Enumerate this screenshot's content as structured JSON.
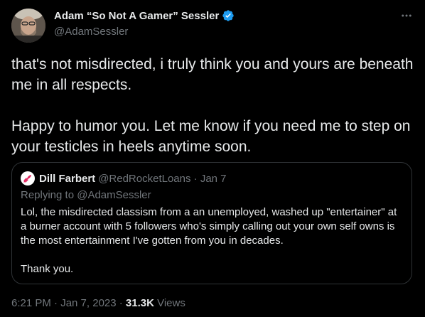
{
  "tweet": {
    "author": {
      "display_name": "Adam “So Not A Gamer” Sessler",
      "handle": "@AdamSessler",
      "verified": true
    },
    "text": {
      "paragraph1": "that's not misdirected, i truly think you and yours are beneath me in all respects.",
      "paragraph2": "Happy to humor you. Let me know if you need me to step on your testicles in heels anytime soon."
    },
    "quoted": {
      "display_name": "Dill Farbert",
      "meta": "@RedRocketLoans · Jan 7",
      "replying_to": "Replying to @AdamSessler",
      "paragraph1": "Lol, the misdirected classism from a an unemployed, washed up \"entertainer\" at a burner account with 5 followers who's simply calling out your own self owns is the most entertainment I've gotten from you in decades.",
      "paragraph2": "Thank you."
    },
    "footer": {
      "timestamp": "6:21 PM · Jan 7, 2023 · ",
      "views_count": "31.3K",
      "views_label": " Views"
    }
  },
  "colors": {
    "background": "#000000",
    "text": "#e7e9ea",
    "secondary": "#71767b",
    "border": "#2f3336",
    "verified": "#1d9bf0",
    "quoted_avatar_accent": "#e0245e"
  },
  "icons": {
    "verified": "verified-badge-icon",
    "more": "more-horizontal-icon",
    "quoted_avatar": "rocket-logo-icon"
  }
}
